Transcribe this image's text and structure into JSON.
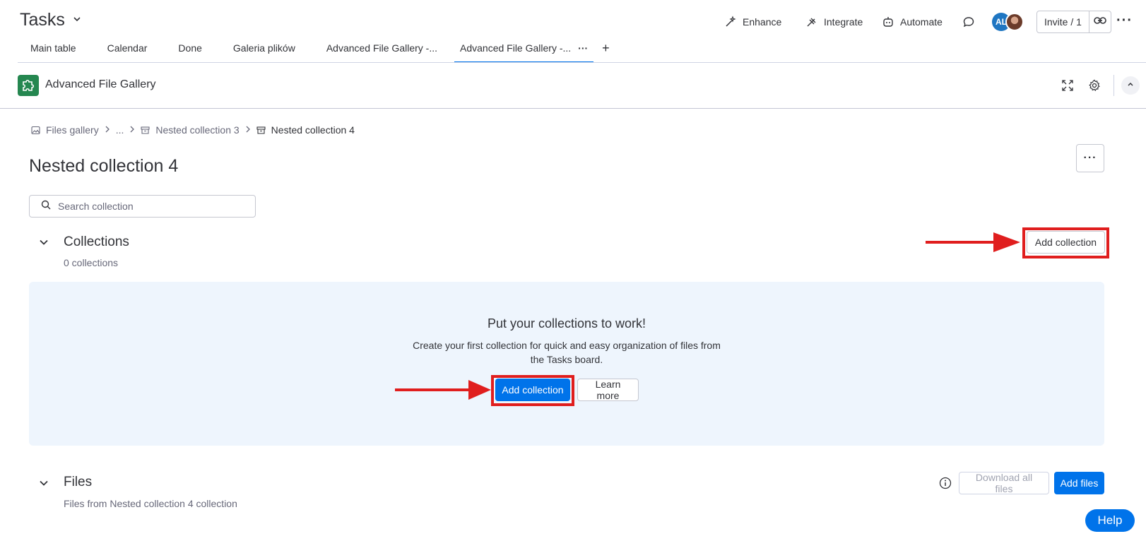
{
  "header": {
    "board_title": "Tasks",
    "actions": {
      "enhance": "Enhance",
      "integrate": "Integrate",
      "automate": "Automate"
    },
    "avatar_initials": "AL",
    "invite_label": "Invite / 1"
  },
  "tabs": [
    {
      "label": "Main table"
    },
    {
      "label": "Calendar"
    },
    {
      "label": "Done"
    },
    {
      "label": "Galeria plików"
    },
    {
      "label": "Advanced File Gallery -..."
    },
    {
      "label": "Advanced File Gallery -...",
      "active": true
    }
  ],
  "tab_add_label": "+",
  "app": {
    "name": "Advanced File Gallery"
  },
  "breadcrumb": {
    "root": "Files gallery",
    "ellipsis": "...",
    "parent": "Nested collection 3",
    "current": "Nested collection 4"
  },
  "page": {
    "title": "Nested collection 4",
    "search_placeholder": "Search collection"
  },
  "collections": {
    "title": "Collections",
    "count": "0 collections",
    "add_button": "Add collection",
    "empty": {
      "title": "Put your collections to work!",
      "description": "Create your first collection for quick and easy organization of files from the Tasks board.",
      "add_button": "Add collection",
      "learn_more": "Learn more"
    }
  },
  "files": {
    "title": "Files",
    "subtitle": "Files from Nested collection 4 collection",
    "download_all": "Download all files",
    "add_files": "Add files"
  },
  "help_label": "Help",
  "colors": {
    "primary": "#0073ea",
    "highlight": "#e01e1e",
    "panel": "#eef5fd",
    "app_icon": "#258750"
  }
}
